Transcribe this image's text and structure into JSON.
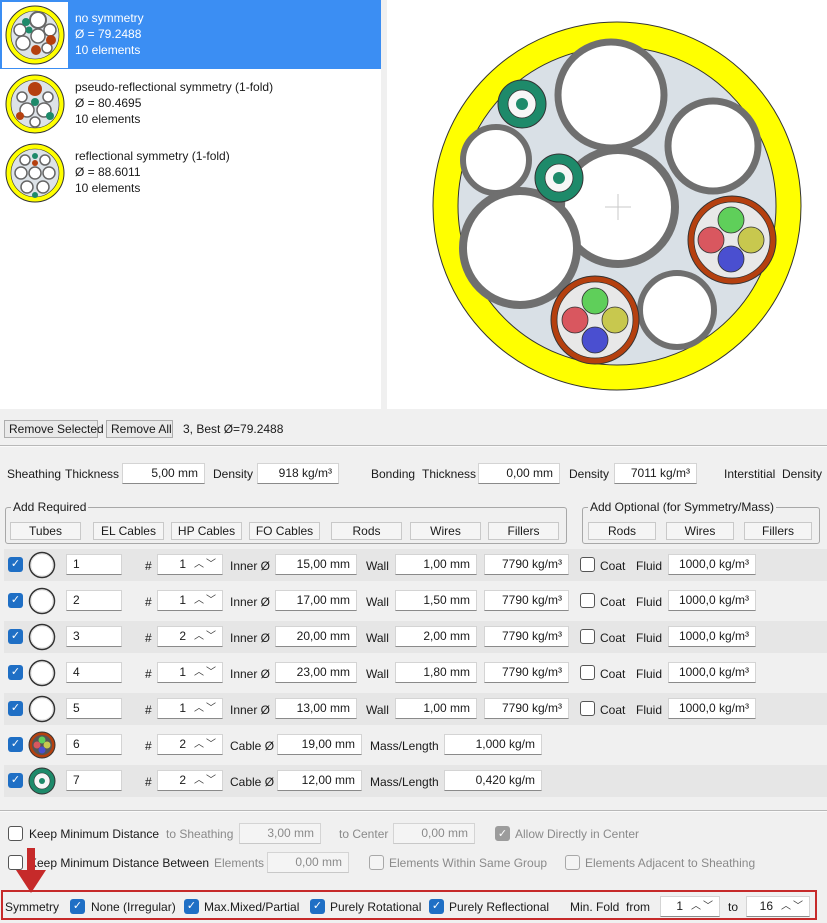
{
  "solutions": [
    {
      "title": "no symmetry",
      "diameter": "Ø = 79.2488",
      "count": "10 elements",
      "selected": true
    },
    {
      "title": "pseudo-reflectional symmetry (1-fold)",
      "diameter": "Ø = 80.4695",
      "count": "10 elements",
      "selected": false
    },
    {
      "title": "reflectional symmetry (1-fold)",
      "diameter": "Ø = 88.6011",
      "count": "10 elements",
      "selected": false
    }
  ],
  "toolbar": {
    "remove_selected": "Remove Selected",
    "remove_all": "Remove All",
    "status": "3, Best Ø=79.2488"
  },
  "sheathing": {
    "label": "Sheathing",
    "thickness_label": "Thickness",
    "thickness": "5,00 mm",
    "density_label": "Density",
    "density": "918 kg/m³"
  },
  "bonding": {
    "label": "Bonding",
    "thickness_label": "Thickness",
    "thickness": "0,00 mm",
    "density_label": "Density",
    "density": "7011 kg/m³"
  },
  "interstitial": {
    "label": "Interstitial",
    "density_label": "Density"
  },
  "add_required": {
    "title": "Add Required",
    "buttons": [
      "Tubes",
      "EL Cables",
      "HP Cables",
      "FO Cables",
      "Rods",
      "Wires",
      "Fillers"
    ]
  },
  "add_optional": {
    "title": "Add Optional (for Symmetry/Mass)",
    "buttons": [
      "Rods",
      "Wires",
      "Fillers"
    ]
  },
  "labels": {
    "hash": "#",
    "inner": "Inner Ø",
    "wall": "Wall",
    "coat": "Coat",
    "fluid": "Fluid",
    "cable": "Cable Ø",
    "mass": "Mass/Length"
  },
  "elements": [
    {
      "name": "1",
      "count": "1",
      "inner": "15,00 mm",
      "wall": "1,00 mm",
      "density": "7790 kg/m³",
      "fluid": "1000,0 kg/m³",
      "icon": "tube-icon"
    },
    {
      "name": "2",
      "count": "1",
      "inner": "17,00 mm",
      "wall": "1,50 mm",
      "density": "7790 kg/m³",
      "fluid": "1000,0 kg/m³",
      "icon": "tube-icon"
    },
    {
      "name": "3",
      "count": "2",
      "inner": "20,00 mm",
      "wall": "2,00 mm",
      "density": "7790 kg/m³",
      "fluid": "1000,0 kg/m³",
      "icon": "tube-icon"
    },
    {
      "name": "4",
      "count": "1",
      "inner": "23,00 mm",
      "wall": "1,80 mm",
      "density": "7790 kg/m³",
      "fluid": "1000,0 kg/m³",
      "icon": "tube-icon"
    },
    {
      "name": "5",
      "count": "1",
      "inner": "13,00 mm",
      "wall": "1,00 mm",
      "density": "7790 kg/m³",
      "fluid": "1000,0 kg/m³",
      "icon": "tube-icon"
    },
    {
      "name": "6",
      "count": "2",
      "cable": "19,00 mm",
      "mass": "1,000 kg/m",
      "icon": "el-cable-icon"
    },
    {
      "name": "7",
      "count": "2",
      "cable": "12,00 mm",
      "mass": "0,420 kg/m",
      "icon": "fo-cable-icon"
    }
  ],
  "constraints": {
    "keep_min_distance": "Keep Minimum Distance",
    "to_sheathing_label": "to Sheathing",
    "to_sheathing": "3,00 mm",
    "to_center_label": "to Center",
    "to_center": "0,00 mm",
    "allow_center": "Allow Directly in Center",
    "keep_min_between": "Keep Minimum Distance Between",
    "elements_label": "Elements",
    "elements": "0,00 mm",
    "same_group": "Elements Within Same Group",
    "adjacent_sheathing": "Elements Adjacent to Sheathing"
  },
  "symmetry": {
    "label": "Symmetry",
    "none": "None (Irregular)",
    "mixed": "Max.Mixed/Partial",
    "rotational": "Purely Rotational",
    "reflectional": "Purely Reflectional",
    "min_fold_label": "Min. Fold",
    "from_label": "from",
    "from": "1",
    "to_label": "to",
    "to": "16"
  },
  "colors": {
    "sheath": "#ffff00",
    "highlight": "#c62a2a",
    "accent": "#1f6fc5",
    "selection": "#3b8ef3"
  }
}
